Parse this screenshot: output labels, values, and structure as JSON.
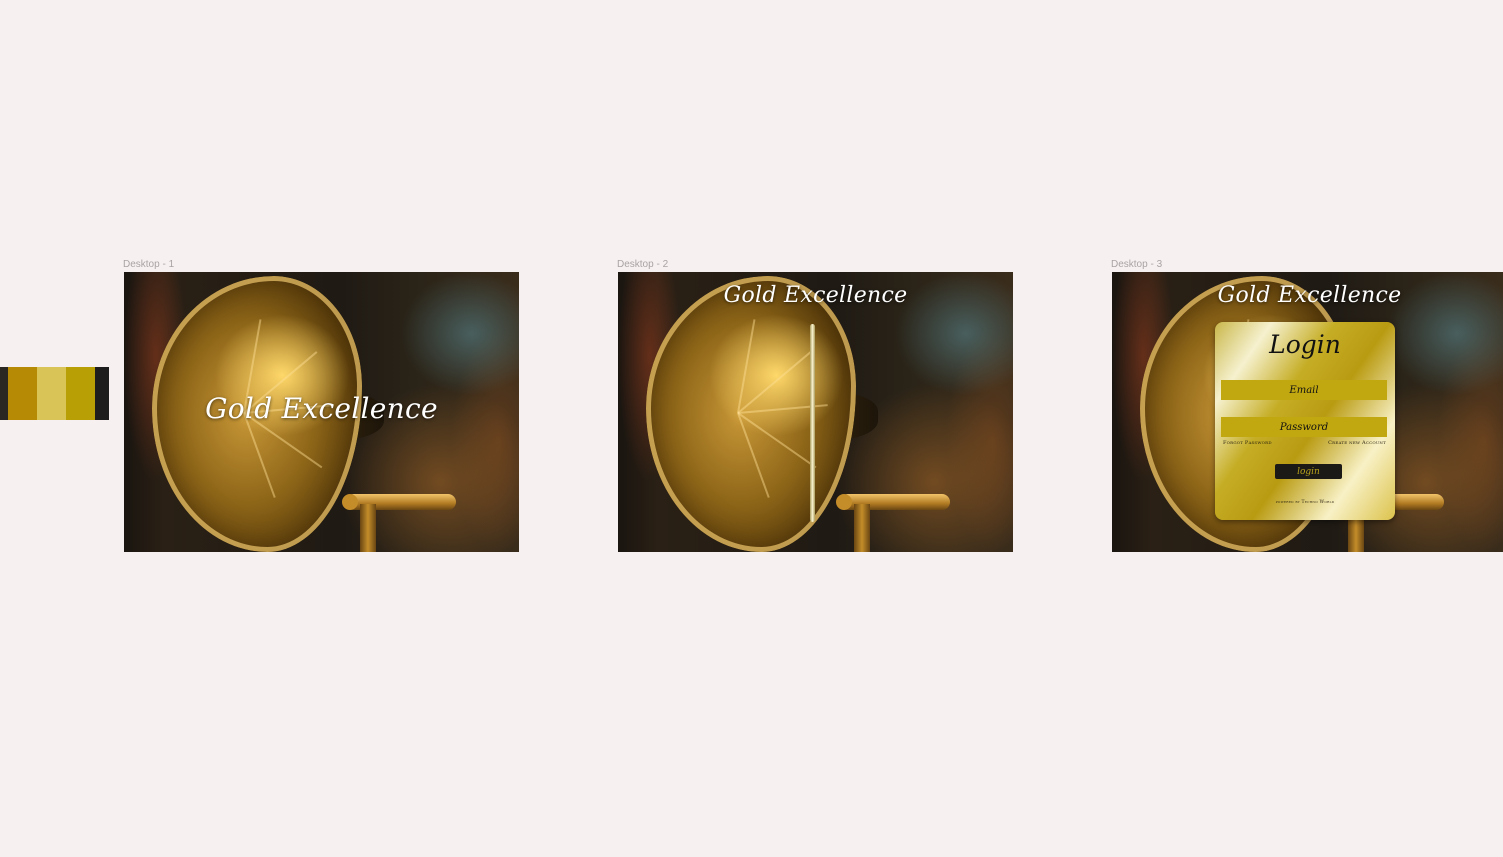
{
  "colors": {
    "canvas_background": "#f6f0f0",
    "palette": [
      "#2a2723",
      "#b68a04",
      "#d9c457",
      "#b89f06",
      "#1d1d1d"
    ]
  },
  "frames": [
    {
      "label": "Desktop - 1",
      "brand": "Gold Excellence"
    },
    {
      "label": "Desktop - 2",
      "brand": "Gold Excellence"
    },
    {
      "label": "Desktop - 3",
      "brand": "Gold Excellence"
    }
  ],
  "login": {
    "title": "Login",
    "email_placeholder": "Email",
    "password_placeholder": "Password",
    "forgot_password": "Forgot Password",
    "create_account": "Create new Account",
    "button_label": "login",
    "powered_by": "powered by Techno World"
  }
}
